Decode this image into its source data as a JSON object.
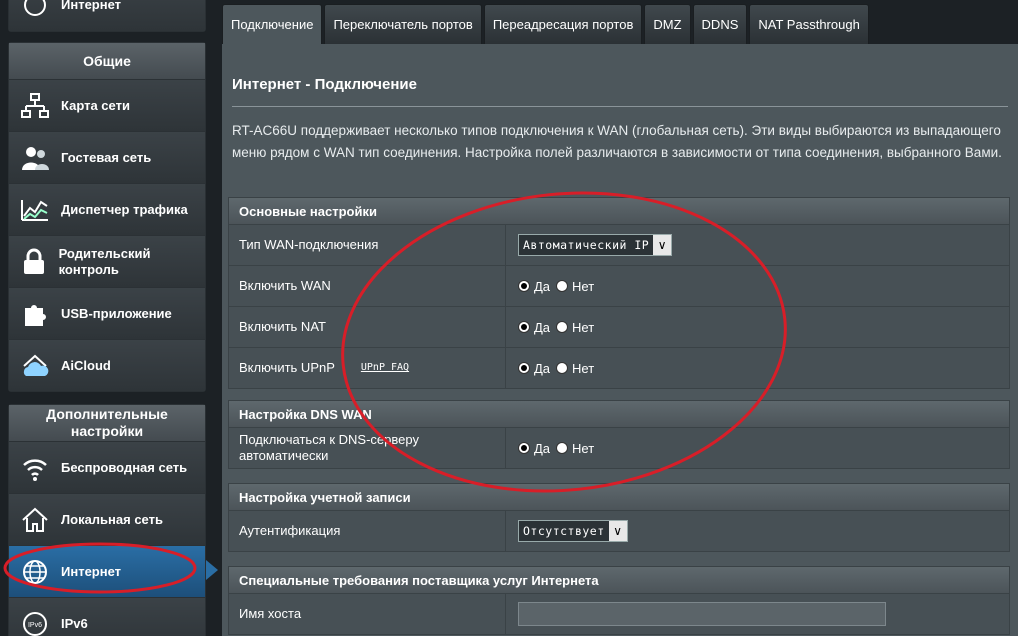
{
  "sidebar": {
    "top_item": {
      "label": "Интернет",
      "icon": "globe-icon"
    },
    "general": {
      "title": "Общие",
      "items": [
        {
          "label": "Карта сети",
          "icon": "network-map-icon"
        },
        {
          "label": "Гостевая сеть",
          "icon": "guest-network-icon"
        },
        {
          "label": "Диспетчер трафика",
          "icon": "traffic-manager-icon"
        },
        {
          "label": "Родительский контроль",
          "icon": "lock-icon"
        },
        {
          "label": "USB-приложение",
          "icon": "puzzle-icon"
        },
        {
          "label": "AiCloud",
          "icon": "cloud-icon"
        }
      ]
    },
    "advanced": {
      "title": "Дополнительные настройки",
      "items": [
        {
          "label": "Беспроводная сеть",
          "icon": "wifi-icon"
        },
        {
          "label": "Локальная сеть",
          "icon": "home-icon"
        },
        {
          "label": "Интернет",
          "icon": "globe-icon",
          "active": true
        },
        {
          "label": "IPv6",
          "icon": "ipv6-icon"
        }
      ]
    }
  },
  "tabs": [
    {
      "label": "Подключение",
      "active": true
    },
    {
      "label": "Переключатель портов"
    },
    {
      "label": "Переадресация портов"
    },
    {
      "label": "DMZ"
    },
    {
      "label": "DDNS"
    },
    {
      "label": "NAT Passthrough"
    }
  ],
  "main": {
    "title": "Интернет - Подключение",
    "description": "RT-AC66U поддерживает несколько типов подключения к WAN (глобальная сеть). Эти виды выбираются из выпадающего меню рядом с WAN тип соединения. Настройка полей различаются в зависимости от типа соединения, выбранного Вами.",
    "sections": {
      "basic": {
        "title": "Основные настройки",
        "wan_type_label": "Тип WAN-подключения",
        "wan_type_value": "Автоматический IP",
        "enable_wan_label": "Включить WAN",
        "enable_nat_label": "Включить NAT",
        "enable_upnp_label": "Включить UPnP",
        "upnp_faq": "UPnP  FAQ"
      },
      "dns": {
        "title": "Настройка DNS WAN",
        "dns_auto_label": "Подключаться к DNS-серверу автоматически"
      },
      "account": {
        "title": "Настройка учетной записи",
        "auth_label": "Аутентификация",
        "auth_value": "Отсутствует"
      },
      "isp": {
        "title": "Специальные требования поставщика услуг Интернета",
        "hostname_label": "Имя хоста",
        "hostname_value": ""
      }
    },
    "radio": {
      "yes": "Да",
      "no": "Нет"
    }
  },
  "colors": {
    "annotation": "#d81e28",
    "active_blue": "#2a6ea5"
  }
}
